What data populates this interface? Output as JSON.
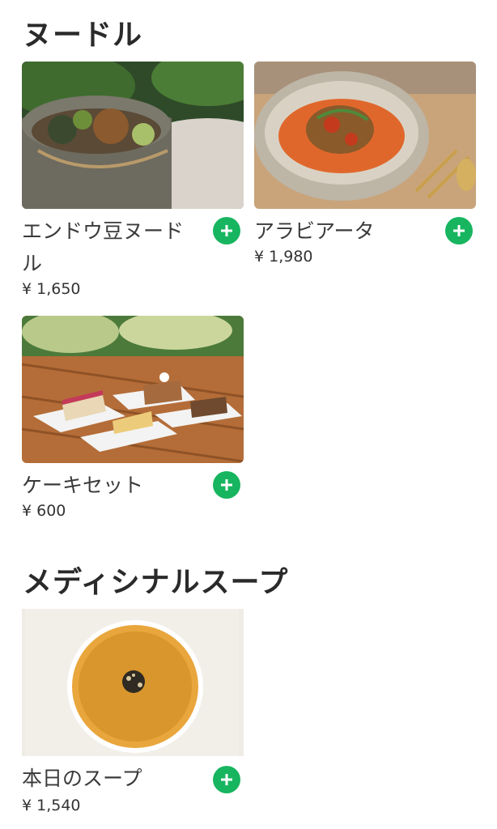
{
  "sections": [
    {
      "title": "ヌードル",
      "items": [
        {
          "name": "エンドウ豆ヌードル",
          "price": "¥ 1,650",
          "icon": "plus-icon"
        },
        {
          "name": "アラビアータ",
          "price": "¥ 1,980",
          "icon": "plus-icon"
        },
        {
          "name": "ケーキセット",
          "price": "¥ 600",
          "icon": "plus-icon"
        }
      ]
    },
    {
      "title": "メディシナルスープ",
      "items": [
        {
          "name": "本日のスープ",
          "price": "¥ 1,540",
          "icon": "plus-icon"
        }
      ]
    }
  ],
  "colors": {
    "accent": "#17b55f",
    "text": "#333333"
  }
}
